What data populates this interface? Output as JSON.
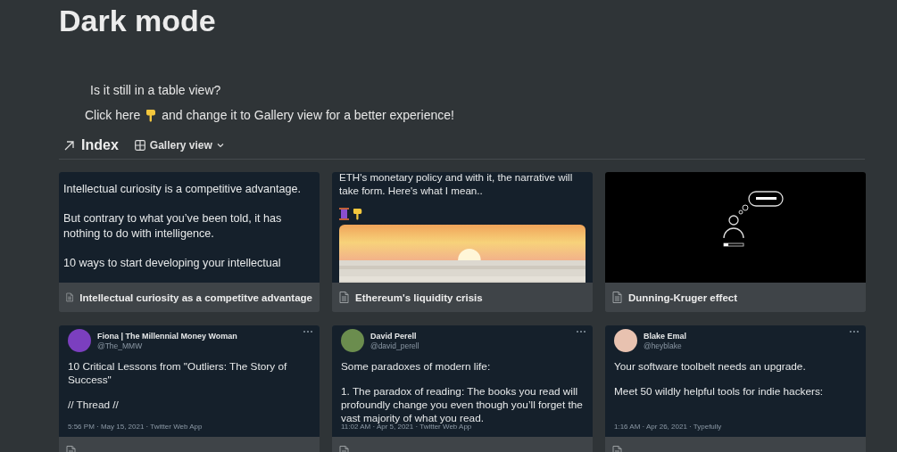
{
  "page": {
    "title": "Dark mode"
  },
  "callout": {
    "question": "Is it still in a table view?",
    "prompt_before": "Click here",
    "prompt_after": "and change it to Gallery view for a better experience!"
  },
  "database": {
    "title": "Index",
    "view": "Gallery view"
  },
  "cards": [
    {
      "kind": "text_tweet",
      "body": [
        "Intellectual curiosity is a competitive advantage.",
        "But contrary to what you’ve been told, it has nothing to do with intelligence.",
        "10 ways to start developing your intellectual"
      ],
      "caption": "Intellectual curiosity as a competitve advantage"
    },
    {
      "kind": "image_tweet",
      "body": [
        "ETH's monetary policy and with it, the narrative will take form. Here's what I mean.."
      ],
      "caption": "Ethereum's liquidity crisis"
    },
    {
      "kind": "illustration",
      "caption": "Dunning-Kruger effect"
    },
    {
      "kind": "tweet",
      "author": "Fiona | The Millennial Money Woman",
      "handle": "@The_MMW",
      "body": [
        "10 Critical Lessons from \"Outliers: The Story of Success\"",
        "// Thread //"
      ],
      "meta": "5:56 PM · May 15, 2021 · Twitter Web App"
    },
    {
      "kind": "tweet",
      "author": "David Perell",
      "handle": "@david_perell",
      "body": [
        "Some paradoxes of modern life:",
        "1. The paradox of reading: The books you read will profoundly change you even though you’ll forget the vast majority of what you read."
      ],
      "meta": "11:02 AM · Apr 5, 2021 · Twitter Web App"
    },
    {
      "kind": "tweet",
      "author": "Blake Emal",
      "handle": "@heyblake",
      "body": [
        "Your software toolbelt needs an upgrade.",
        "Meet 50 wildly helpful tools for indie hackers:"
      ],
      "meta": "1:16 AM · Apr 26, 2021 · Typefully"
    }
  ]
}
